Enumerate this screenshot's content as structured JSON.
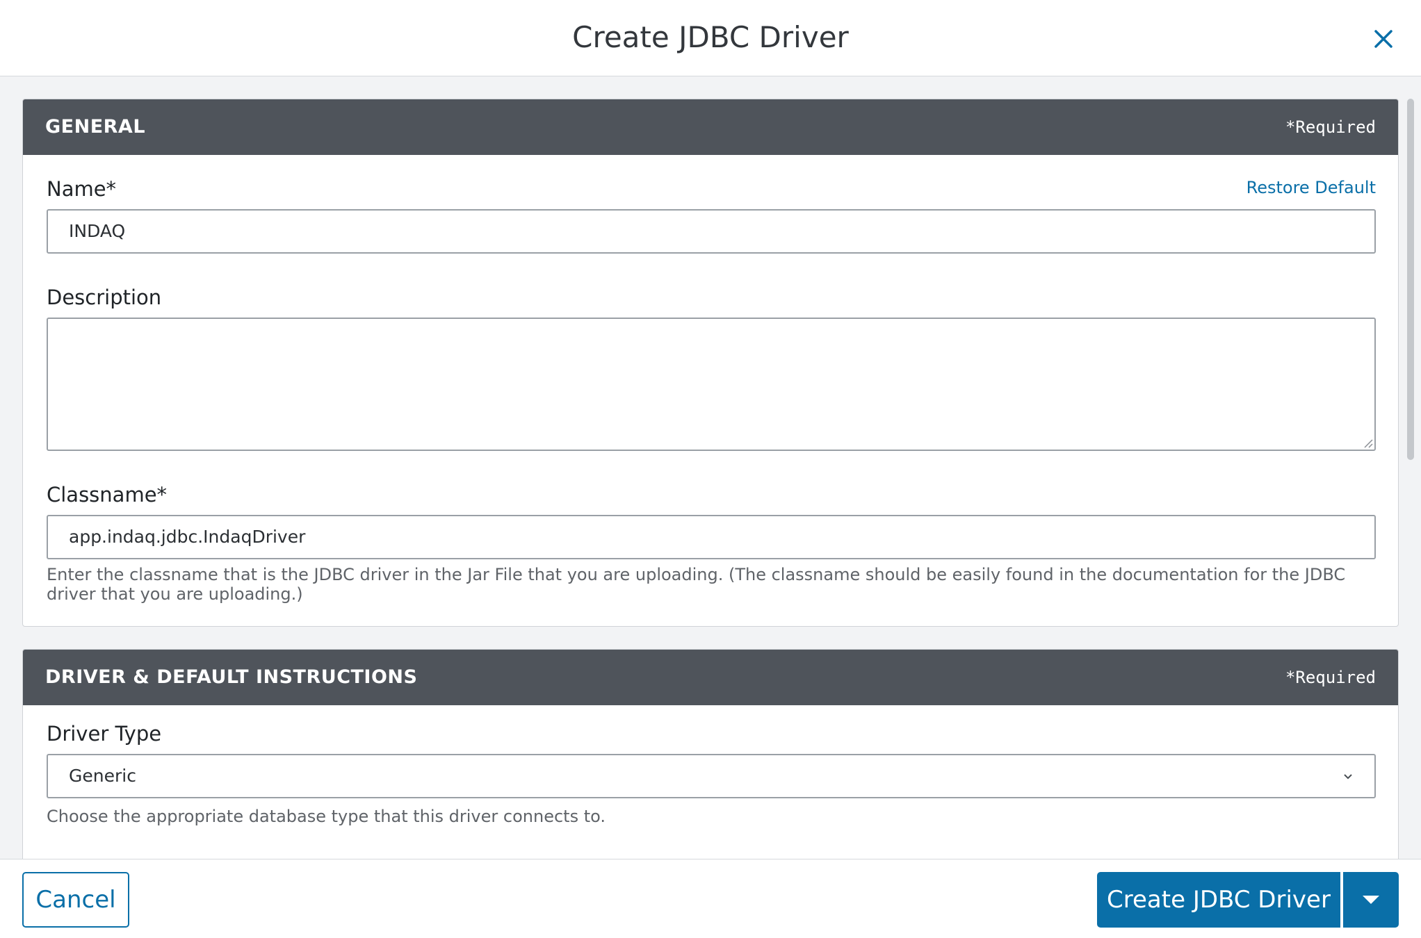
{
  "dialog": {
    "title": "Create JDBC Driver"
  },
  "general": {
    "title": "GENERAL",
    "required_note": "*Required",
    "name": {
      "label": "Name*",
      "restore_default": "Restore Default",
      "value": "INDAQ"
    },
    "description": {
      "label": "Description",
      "value": ""
    },
    "classname": {
      "label": "Classname*",
      "value": "app.indaq.jdbc.IndaqDriver",
      "help": "Enter the classname that is the JDBC driver in the Jar File that you are uploading. (The classname should be easily found in the documentation for the JDBC driver that you are uploading.)"
    }
  },
  "driver": {
    "title": "DRIVER & DEFAULT INSTRUCTIONS",
    "required_note": "*Required",
    "driver_type": {
      "label": "Driver Type",
      "value": "Generic",
      "help": "Choose the appropriate database type that this driver connects to."
    }
  },
  "footer": {
    "cancel_label": "Cancel",
    "create_label": "Create JDBC Driver"
  },
  "colors": {
    "accent": "#0a6fa8",
    "section_header": "#4f545b",
    "background": "#f2f3f5"
  },
  "icons": {
    "close": "close-icon",
    "select": "chevron-down-icon",
    "split": "caret-down-icon",
    "resize": "resize-grip-icon"
  }
}
